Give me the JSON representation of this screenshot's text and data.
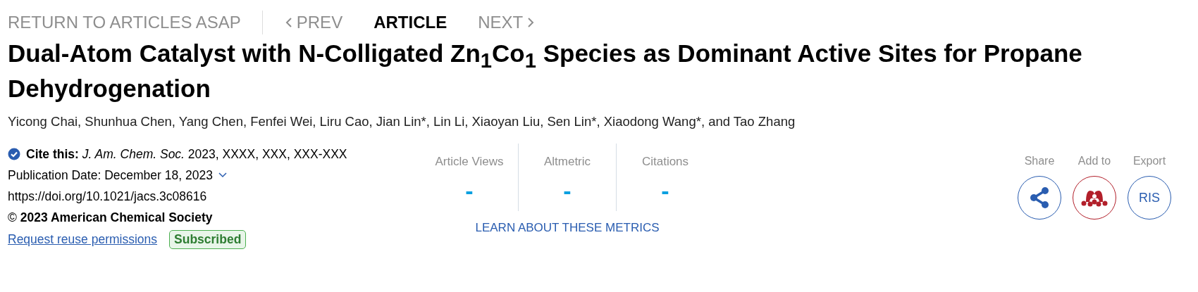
{
  "nav": {
    "back_link": "RETURN TO ARTICLES ASAP",
    "items": [
      {
        "kind": "prev",
        "label": "PREV",
        "selected": false
      },
      {
        "kind": "current",
        "label": "ARTICLE",
        "selected": true
      },
      {
        "kind": "next",
        "label": "NEXT",
        "selected": false
      }
    ]
  },
  "title": "Dual-Atom Catalyst with N-Colligated Zn$_{1}$Co$_{1}$ Species as Dominant Active Sites for Propane Dehydrogenation",
  "authors": "Yicong Chai, Shunhua Chen, Yang Chen, Fenfei Wei, Liru Cao, Jian Lin*, Lin Li, Xiaoyan Liu, Sen Lin*, Xiaodong Wang*, and Tao Zhang",
  "citation": {
    "cite": "**Cite this:** *J. Am. Chem. Soc.*  2023, XXXX, XXX, XXX-XXX",
    "publication_date": "Publication Date: December 18, 2023",
    "doi": "https://doi.org/10.1021/jacs.3c08616",
    "copyright": "© **2023 American Chemical Society**",
    "permissions_link": "Request reuse permissions",
    "access_badge": "Subscribed"
  },
  "metrics": {
    "items": [
      {
        "label": "Article Views",
        "value": "-"
      },
      {
        "label": "Altmetric",
        "value": "-"
      },
      {
        "label": "Citations",
        "value": "-"
      }
    ],
    "link": "LEARN ABOUT THESE METRICS"
  },
  "actions": [
    {
      "kind": "share",
      "label": "Share"
    },
    {
      "kind": "mendeley",
      "label": "Add to"
    },
    {
      "kind": "ris",
      "label": "Export",
      "button_text": "RIS"
    }
  ]
}
